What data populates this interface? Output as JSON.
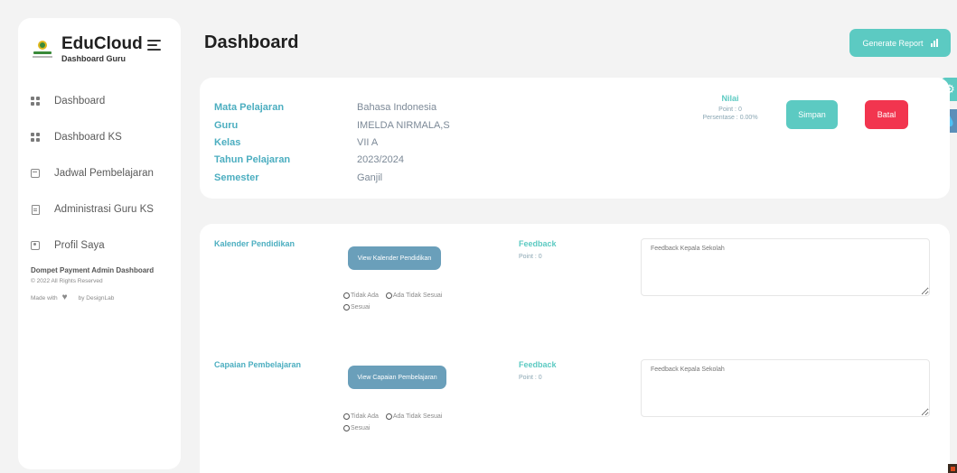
{
  "brand": {
    "title": "EduCloud",
    "subtitle": "Dashboard Guru"
  },
  "sidebar": {
    "items": [
      {
        "label": "Dashboard",
        "icon": "grid-icon"
      },
      {
        "label": "Dashboard KS",
        "icon": "grid-icon"
      },
      {
        "label": "Jadwal Pembelajaran",
        "icon": "calendar-icon"
      },
      {
        "label": "Administrasi Guru KS",
        "icon": "document-icon"
      },
      {
        "label": "Profil Saya",
        "icon": "profile-icon"
      }
    ],
    "footer": {
      "title": "Dompet Payment Admin Dashboard",
      "copyright": "© 2022 All Rights Reserved",
      "made_with": "Made with",
      "by": "by DesignLab"
    }
  },
  "header": {
    "title": "Dashboard",
    "generate_report": "Generate Report"
  },
  "info": {
    "rows": [
      {
        "label": "Mata Pelajaran",
        "value": "Bahasa Indonesia"
      },
      {
        "label": "Guru",
        "value": "IMELDA NIRMALA,S"
      },
      {
        "label": "Kelas",
        "value": "VII A"
      },
      {
        "label": "Tahun Pelajaran",
        "value": "2023/2024"
      },
      {
        "label": "Semester",
        "value": "Ganjil"
      }
    ],
    "nilai": {
      "title": "Nilai",
      "point": "Point : 0",
      "persentase": "Persentase : 0.00%"
    },
    "simpan": "Simpan",
    "batal": "Batal"
  },
  "sections": [
    {
      "label": "Kalender Pendidikan",
      "button": "View Kalender Pendidikan",
      "feedback_title": "Feedback",
      "feedback_point": "Point : 0",
      "textarea_placeholder": "Feedback Kepala Sekolah",
      "options": [
        "Tidak Ada",
        "Ada Tidak Sesuai",
        "Sesuai"
      ]
    },
    {
      "label": "Capaian Pembelajaran",
      "button": "View Capaian Pembelajaran",
      "feedback_title": "Feedback",
      "feedback_point": "Point : 0",
      "textarea_placeholder": "Feedback Kepala Sekolah",
      "options": [
        "Tidak Ada",
        "Ada Tidak Sesuai",
        "Sesuai"
      ]
    }
  ],
  "colors": {
    "accent": "#5ccac2",
    "label_blue": "#4caec0",
    "danger": "#f2354f",
    "button_blue": "#6a9fba"
  }
}
